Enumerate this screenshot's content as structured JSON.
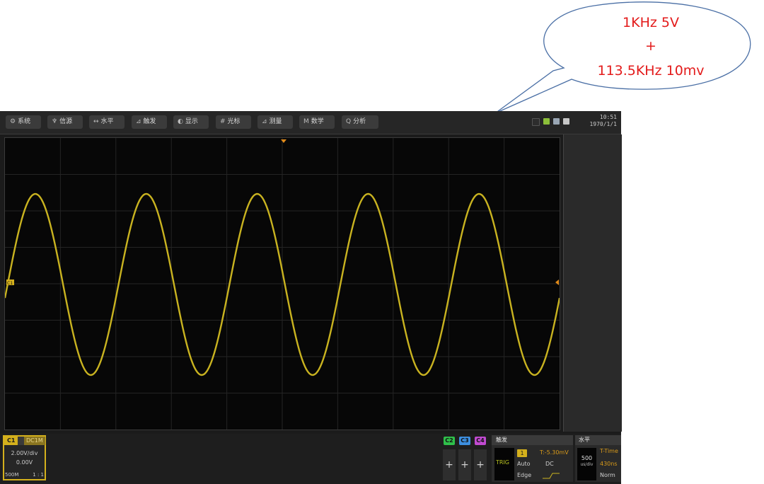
{
  "callout": {
    "line1": "1KHz 5V",
    "line2": "+",
    "line3": "113.5KHz 10mv",
    "text_color": "#e31b1b"
  },
  "menu": {
    "items": [
      {
        "label": "系统",
        "icon": "gear-icon"
      },
      {
        "label": "信源",
        "icon": "source-icon"
      },
      {
        "label": "水平",
        "icon": "horizontal-icon"
      },
      {
        "label": "触发",
        "icon": "trigger-icon"
      },
      {
        "label": "显示",
        "icon": "display-icon"
      },
      {
        "label": "光标",
        "icon": "cursor-icon"
      },
      {
        "label": "测量",
        "icon": "measure-icon"
      },
      {
        "label": "数学",
        "icon": "math-icon"
      },
      {
        "label": "分析",
        "icon": "search-icon"
      }
    ]
  },
  "clock": {
    "time": "10:51",
    "date": "1970/1/1"
  },
  "waveform": {
    "channel_marker": "C1",
    "cycles_on_screen": 5,
    "trace_color": "#c9b320"
  },
  "channel1": {
    "tag": "C1",
    "coupling": "DC1M",
    "volts_div": "2.00V/div",
    "offset": "0.00V",
    "bandwidth": "500M",
    "probe": "1 : 1",
    "color": "#d4b01c"
  },
  "channels": [
    {
      "tag": "C2",
      "color": "#2fbf4a",
      "plus": "+"
    },
    {
      "tag": "C3",
      "color": "#3d8fe0",
      "plus": "+"
    },
    {
      "tag": "C4",
      "color": "#c04ad0",
      "plus": "+"
    }
  ],
  "trigger": {
    "title": "触发",
    "label": "TRIG",
    "source": "1",
    "level": "T:-5.30mV",
    "mode": "Auto",
    "coupling": "DC",
    "type": "Edge"
  },
  "horizontal": {
    "title": "水平",
    "timebase": "500",
    "unit": "us/div",
    "t_label": "T-Time",
    "delay": "430ns",
    "mode": "Norm"
  }
}
